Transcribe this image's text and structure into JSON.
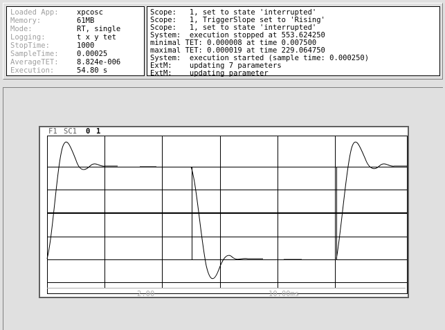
{
  "info": {
    "rows": [
      {
        "label": "Loaded App:",
        "value": "xpcosc"
      },
      {
        "label": "Memory:",
        "value": "61MB"
      },
      {
        "label": "Mode:",
        "value": "RT, single"
      },
      {
        "label": "Logging:",
        "value": "t x y tet"
      },
      {
        "label": "StopTime:",
        "value": "1000"
      },
      {
        "label": "SampleTime:",
        "value": "0.00025"
      },
      {
        "label": "AverageTET:",
        "value": "8.824e-006"
      },
      {
        "label": "Execution:",
        "value": "54.80 s"
      }
    ]
  },
  "log": {
    "lines": [
      "Scope:   1, set to state 'interrupted'",
      "Scope:   1, TriggerSlope set to 'Rising'",
      "Scope:   1, set to state 'interrupted'",
      "System:  execution stopped at 553.624250",
      "minimal TET: 0.000008 at time 0.007500",
      "maximal TET: 0.000019 at time 229.064750",
      "System:  execution started (sample time: 0.000250)",
      "ExtM:    updating 7 parameters",
      "ExtM:    updating parameter"
    ]
  },
  "scope": {
    "figure_label": "F1",
    "scope_label": "SC1",
    "signal_0": "0",
    "signal_1": "1",
    "y_scale": "2.00",
    "x_scale": "10.00ms"
  }
}
